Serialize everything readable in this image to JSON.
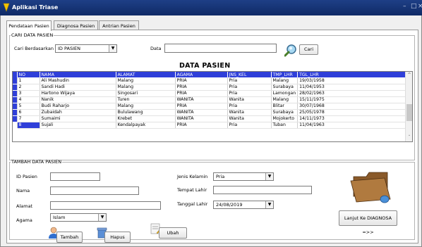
{
  "window": {
    "title": "Aplikasi Triase"
  },
  "tabs": [
    "Pendataan Pasien",
    "Diagnosa Pasien",
    "Antrian Pasien"
  ],
  "search": {
    "legend": "CARI DATA PASIEN",
    "by_label": "Cari Berdasarkan",
    "by_value": "ID PASIEN",
    "data_label": "Data",
    "data_value": "",
    "cari_label": "Cari"
  },
  "table": {
    "title": "DATA PASIEN",
    "columns": [
      "NO",
      "NAMA",
      "ALAMAT",
      "AGAMA",
      "JNS_KEL",
      "TMP_LHR",
      "TGL_LHR"
    ],
    "rows": [
      [
        "1",
        "Ali Mashudin",
        "Malang",
        "PRIA",
        "Pria",
        "Malang",
        "19/03/1958"
      ],
      [
        "2",
        "Sandi Hadi",
        "Malang",
        "PRIA",
        "Pria",
        "Surabaya",
        "11/04/1953"
      ],
      [
        "3",
        "Hartono Wijaya",
        "Singosari",
        "PRIA",
        "Pria",
        "Lamongan",
        "28/02/1963"
      ],
      [
        "4",
        "Nanik",
        "Turen",
        "WANITA",
        "Wanita",
        "Malang",
        "15/11/1975"
      ],
      [
        "5",
        "Budi Raharjo",
        "Malang",
        "PRIA",
        "Pria",
        "Blitar",
        "30/07/1968"
      ],
      [
        "6",
        "Zubaidah",
        "Bululawang",
        "WANITA",
        "Wanita",
        "Surabaya",
        "25/05/1978"
      ],
      [
        "7",
        "Sumaimi",
        "Krebet",
        "WANITA",
        "Wanita",
        "Mojokerto",
        "14/11/1973"
      ],
      [
        "8",
        "Sujali",
        "Kendalpayak",
        "PRIA",
        "Pria",
        "Tuban",
        "11/04/1963"
      ]
    ]
  },
  "form": {
    "legend": "TAMBAH DATA PASIEN",
    "id_label": "ID Pasien",
    "nama_label": "Nama",
    "alamat_label": "Alamat",
    "agama_label": "Agama",
    "agama_value": "Islam",
    "jk_label": "Jenis Kelamin",
    "jk_value": "Pria",
    "tempat_label": "Tempat Lahir",
    "tanggal_label": "Tanggal Lahir",
    "tanggal_value": "24/08/2019",
    "tambah_label": "Tambah",
    "hapus_label": "Hapus",
    "ubah_label": "Ubah",
    "lanjut_label": "Lanjut Ke DIAGNOSA =>>"
  },
  "colors": {
    "titlebar": "#1e3f86",
    "grid_header": "#2f3fd9"
  }
}
